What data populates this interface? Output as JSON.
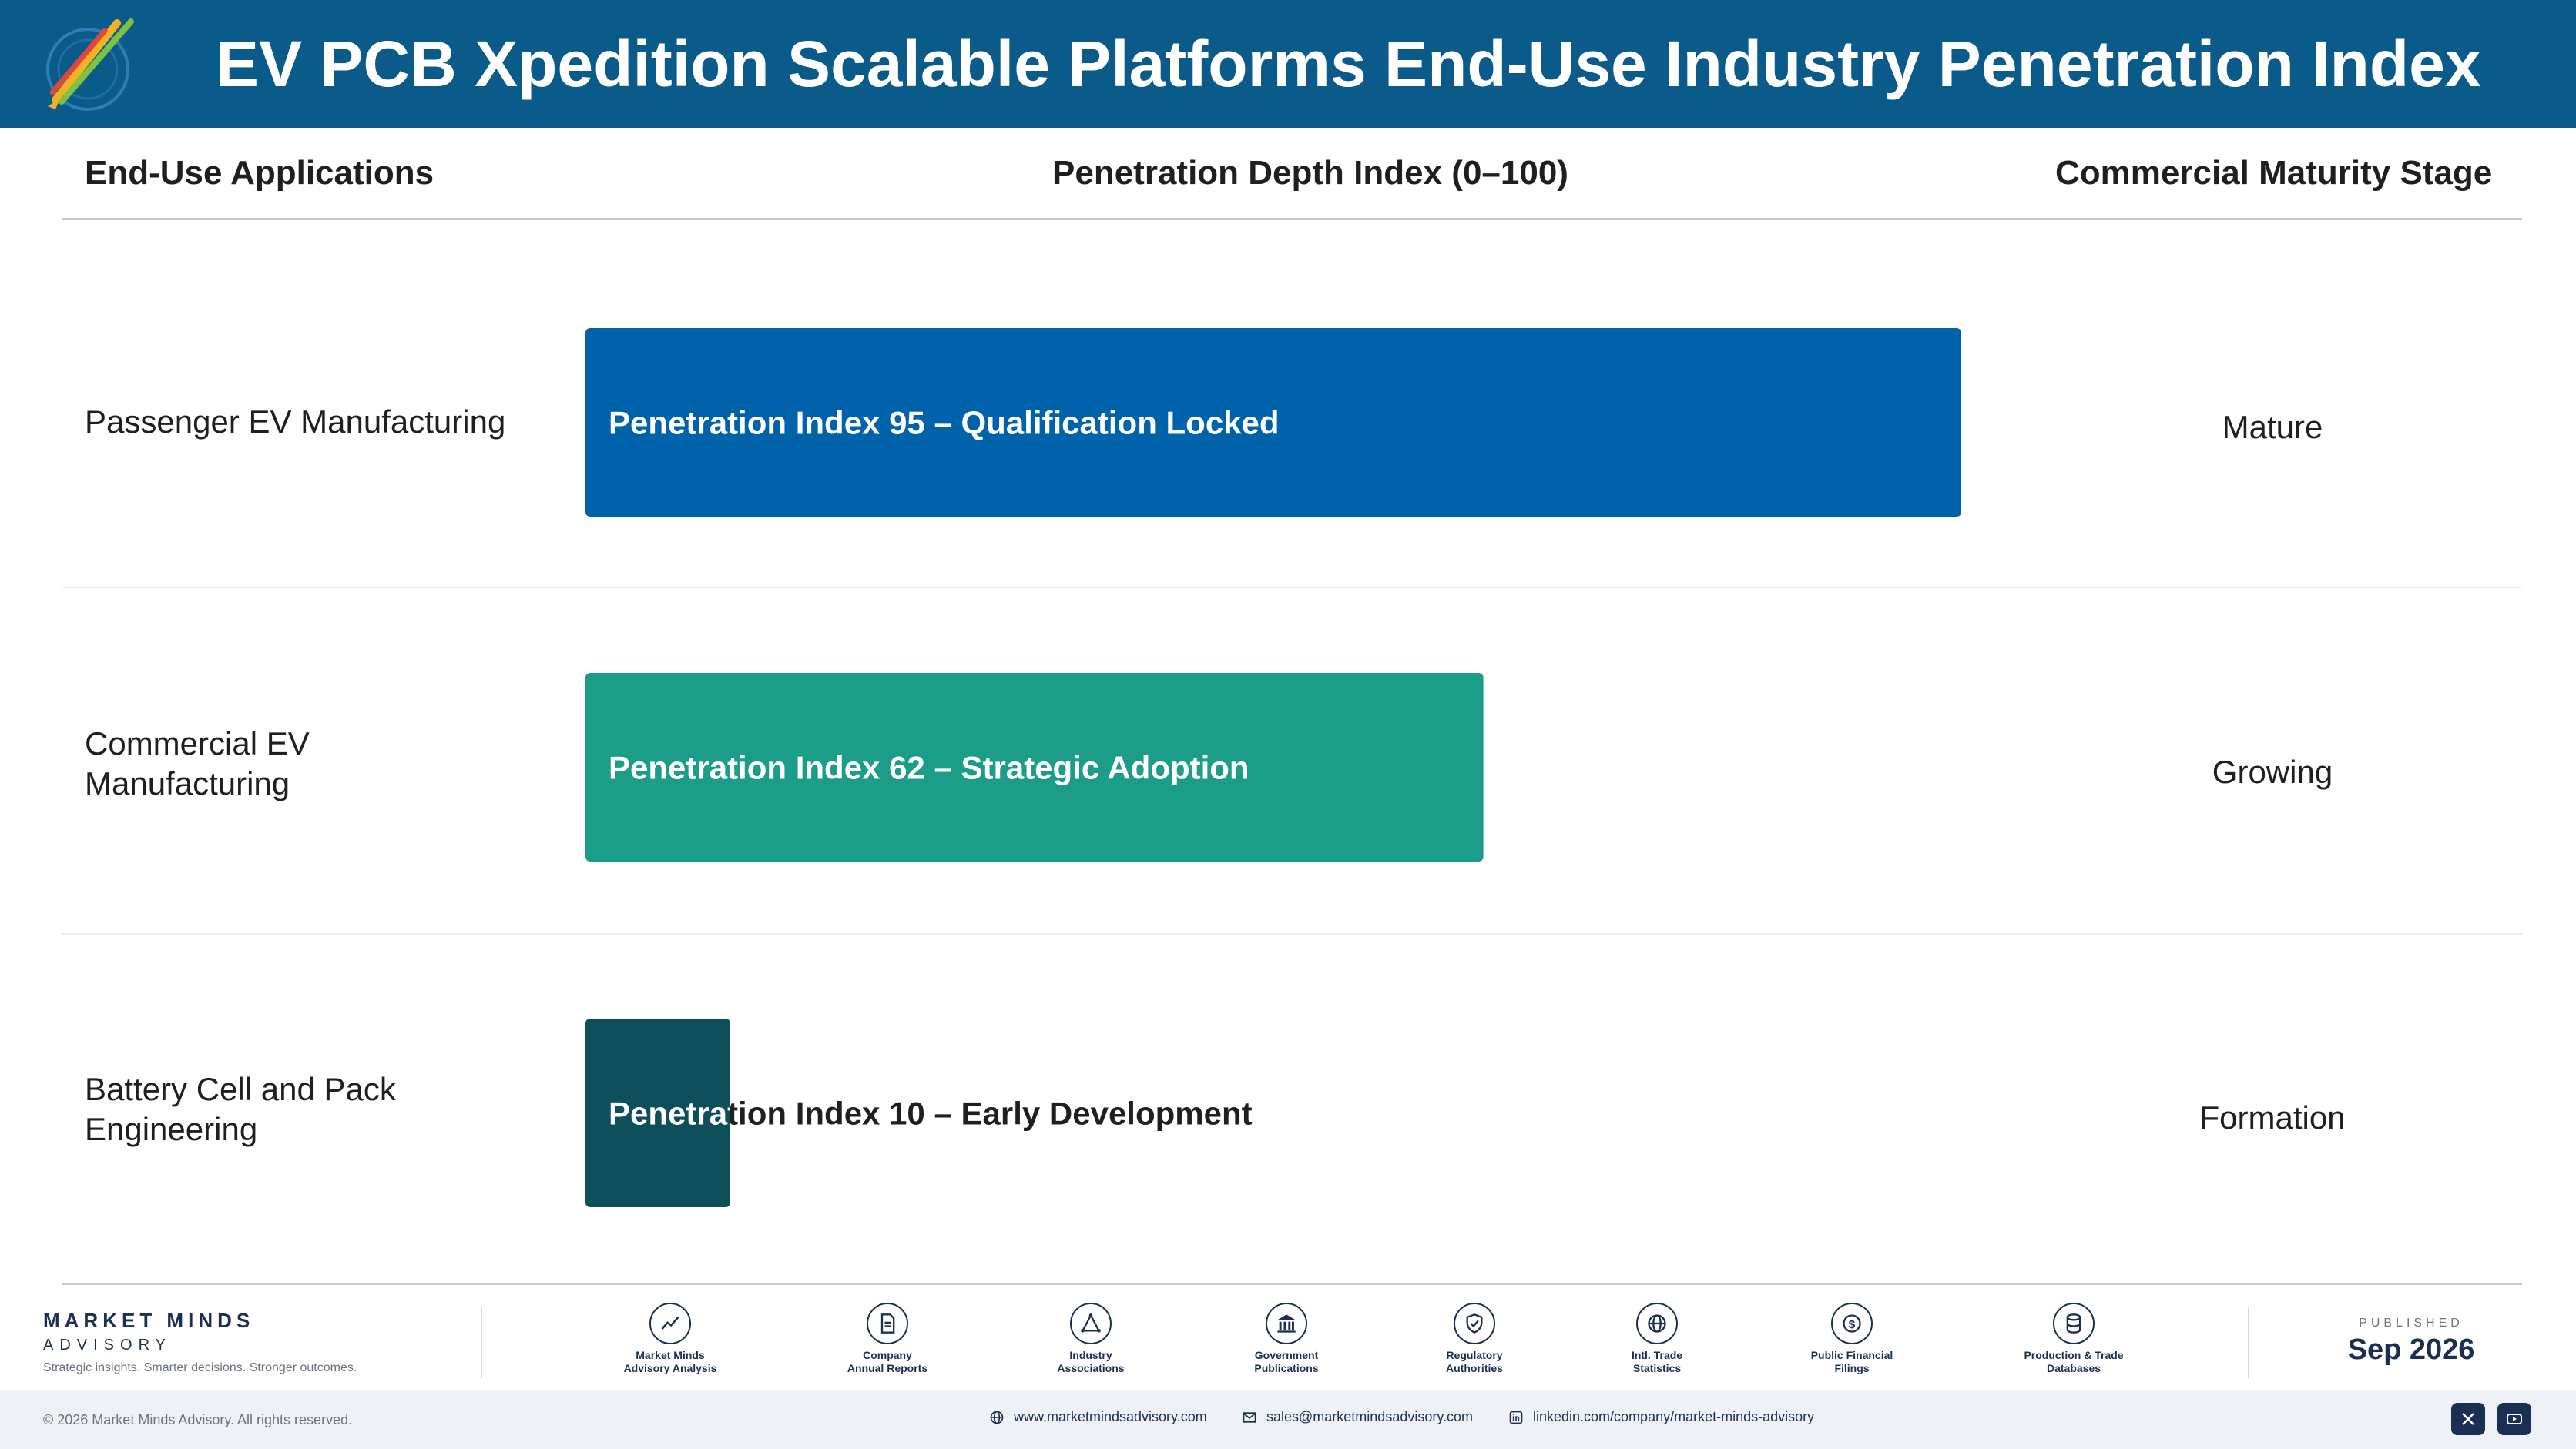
{
  "header": {
    "title": "EV PCB Xpedition Scalable Platforms End-Use Industry Penetration Index"
  },
  "columns": {
    "applications": "End-Use Applications",
    "index": "Penetration Depth Index (0–100)",
    "stage": "Commercial Maturity Stage"
  },
  "rows": [
    {
      "label_lines": [
        "Passenger EV Manufacturing"
      ],
      "stage": "Mature"
    },
    {
      "label_lines": [
        "Commercial EV",
        "Manufacturing"
      ],
      "stage": "Growing"
    },
    {
      "label_lines": [
        "Battery Cell and Pack",
        "Engineering"
      ],
      "stage": "Formation"
    }
  ],
  "chart_data": {
    "type": "bar",
    "orientation": "horizontal",
    "title": "EV PCB Xpedition Scalable Platforms End-Use Industry Penetration Index",
    "xlabel": "Penetration Depth Index (0–100)",
    "ylabel": "End-Use Applications",
    "xlim": [
      0,
      100
    ],
    "grid": false,
    "categories": [
      "Passenger EV Manufacturing",
      "Commercial EV Manufacturing",
      "Battery Cell and Pack Engineering"
    ],
    "values": [
      95,
      62,
      10
    ],
    "data_labels": [
      "Penetration Index 95 – Qualification Locked",
      "Penetration Index 62 – Strategic Adoption",
      "Penetration Index 10 – Early Development"
    ],
    "colors": [
      "#0062ab",
      "#1b9d8a",
      "#0f4f5c"
    ],
    "stages": [
      "Mature",
      "Growing",
      "Formation"
    ]
  },
  "footer": {
    "brand_name": "MARKET MINDS",
    "brand_sub": "ADVISORY",
    "tagline": "Strategic insights. Smarter decisions. Stronger outcomes.",
    "sources": [
      {
        "icon": "trend-chart-icon",
        "lines": [
          "Market Minds",
          "Advisory Analysis"
        ]
      },
      {
        "icon": "document-icon",
        "lines": [
          "Company",
          "Annual Reports"
        ]
      },
      {
        "icon": "network-icon",
        "lines": [
          "Industry",
          "Associations"
        ]
      },
      {
        "icon": "government-building-icon",
        "lines": [
          "Government",
          "Publications"
        ]
      },
      {
        "icon": "shield-check-icon",
        "lines": [
          "Regulatory",
          "Authorities"
        ]
      },
      {
        "icon": "globe-icon",
        "lines": [
          "Intl. Trade",
          "Statistics"
        ]
      },
      {
        "icon": "dollar-coin-icon",
        "lines": [
          "Public Financial",
          "Filings"
        ]
      },
      {
        "icon": "database-icon",
        "lines": [
          "Production & Trade",
          "Databases"
        ]
      }
    ],
    "published_label": "PUBLISHED",
    "published_date": "Sep 2026",
    "copyright": "© 2026 Market Minds Advisory. All rights reserved.",
    "website": "www.marketmindsadvisory.com",
    "email": "sales@marketmindsadvisory.com",
    "linkedin": "linkedin.com/company/market-minds-advisory"
  }
}
